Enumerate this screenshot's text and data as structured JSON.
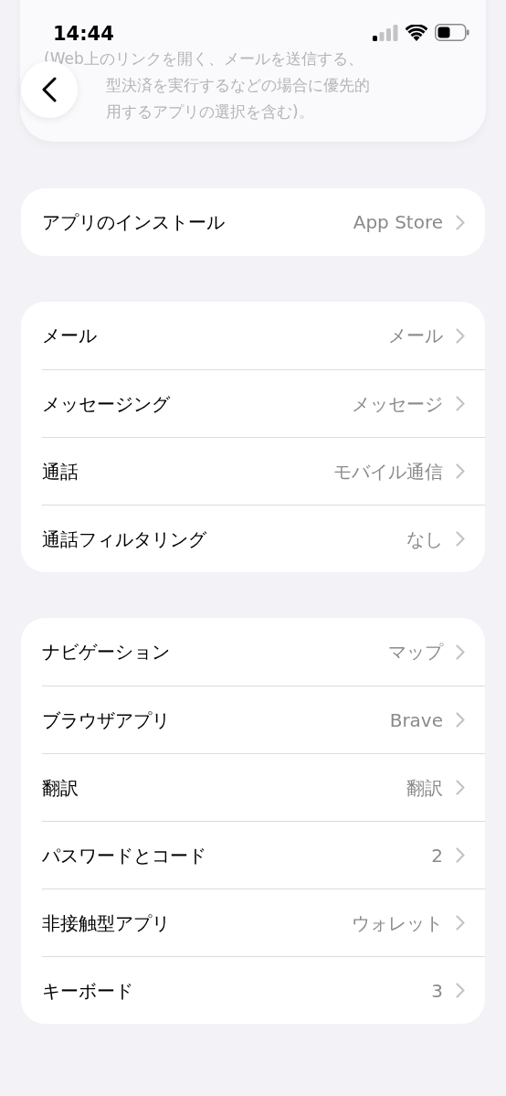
{
  "status_bar": {
    "time": "14:44"
  },
  "description_lines": [
    "(Web上のリンクを開く、メールを送信する、",
    "型決済を実行するなどの場合に優先的",
    "用するアプリの選択を含む)。"
  ],
  "groups": [
    {
      "rows": [
        {
          "label": "アプリのインストール",
          "value": "App Store"
        }
      ]
    },
    {
      "rows": [
        {
          "label": "メール",
          "value": "メール"
        },
        {
          "label": "メッセージング",
          "value": "メッセージ"
        },
        {
          "label": "通話",
          "value": "モバイル通信"
        },
        {
          "label": "通話フィルタリング",
          "value": "なし"
        }
      ]
    },
    {
      "rows": [
        {
          "label": "ナビゲーション",
          "value": "マップ"
        },
        {
          "label": "ブラウザアプリ",
          "value": "Brave"
        },
        {
          "label": "翻訳",
          "value": "翻訳"
        },
        {
          "label": "パスワードとコード",
          "value": "2"
        },
        {
          "label": "非接触型アプリ",
          "value": "ウォレット"
        },
        {
          "label": "キーボード",
          "value": "3"
        }
      ]
    }
  ]
}
